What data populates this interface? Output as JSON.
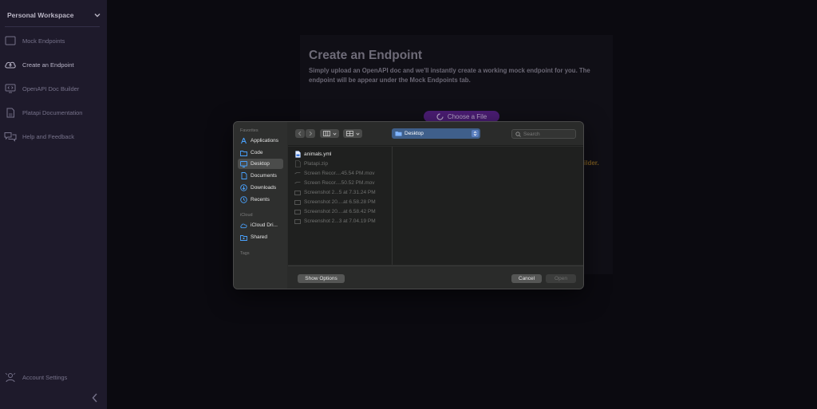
{
  "sidebar": {
    "workspace": "Personal Workspace",
    "items": [
      {
        "label": "Mock Endpoints",
        "icon": "window-icon"
      },
      {
        "label": "Create an Endpoint",
        "icon": "cloud-upload-icon",
        "active": true
      },
      {
        "label": "OpenAPI Doc Builder",
        "icon": "code-window-icon"
      },
      {
        "label": "Platapi Documentation",
        "icon": "document-icon"
      },
      {
        "label": "Help and Feedback",
        "icon": "chat-bubbles-icon"
      }
    ],
    "account": {
      "label": "Account Settings",
      "icon": "person-icon"
    }
  },
  "main": {
    "title": "Create an Endpoint",
    "description": "Simply upload an OpenAPI doc and we'll instantly create a working mock endpoint for you. The endpoint will be appear under the Mock Endpoints tab.",
    "choose_file": "Choose a File",
    "hint_fragment": "ilder."
  },
  "dialog": {
    "sections": {
      "favorites": "Favorites",
      "icloud": "iCloud",
      "tags": "Tags"
    },
    "favorites": [
      {
        "label": "Applications",
        "icon": "applications-icon"
      },
      {
        "label": "Code",
        "icon": "folder-icon"
      },
      {
        "label": "Desktop",
        "icon": "desktop-icon",
        "selected": true
      },
      {
        "label": "Documents",
        "icon": "document-icon"
      },
      {
        "label": "Downloads",
        "icon": "download-icon"
      },
      {
        "label": "Recents",
        "icon": "clock-icon"
      }
    ],
    "icloud": [
      {
        "label": "iCloud Dri...",
        "icon": "cloud-icon"
      },
      {
        "label": "Shared",
        "icon": "shared-folder-icon"
      }
    ],
    "location": "Desktop",
    "search_placeholder": "Search",
    "files": [
      {
        "name": "animals.yml",
        "enabled": true,
        "icon": "yml-file-icon"
      },
      {
        "name": "Platapi.zip",
        "enabled": false,
        "icon": "zip-file-icon"
      },
      {
        "name": "Screen Recor....45.54 PM.mov",
        "enabled": false,
        "icon": "video-file-icon"
      },
      {
        "name": "Screen Recor....50.52 PM.mov",
        "enabled": false,
        "icon": "video-file-icon"
      },
      {
        "name": "Screenshot 2...5 at 7.31.24 PM",
        "enabled": false,
        "icon": "image-file-icon"
      },
      {
        "name": "Screenshot 20....at 6.58.28 PM",
        "enabled": false,
        "icon": "image-file-icon"
      },
      {
        "name": "Screenshot 20....at 6.58.42 PM",
        "enabled": false,
        "icon": "image-file-icon"
      },
      {
        "name": "Screenshot 2...3 at 7.04.19 PM",
        "enabled": false,
        "icon": "image-file-icon"
      }
    ],
    "show_options": "Show Options",
    "cancel": "Cancel",
    "open": "Open"
  },
  "colors": {
    "accent": "#4b1d74",
    "sidebar_bg": "#1e1a2b",
    "location_blue": "#3f5f8a"
  }
}
